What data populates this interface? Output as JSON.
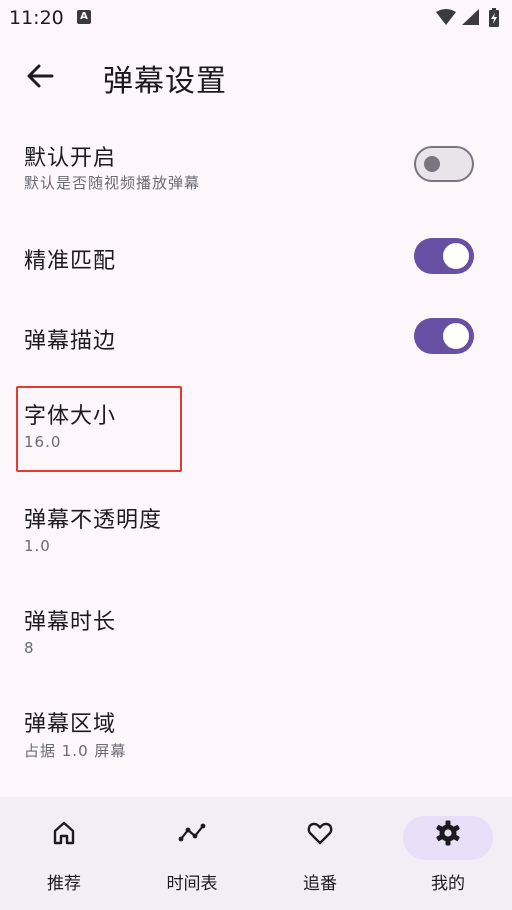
{
  "status": {
    "time": "11:20",
    "notification_icon": "a-icon"
  },
  "header": {
    "title": "弹幕设置",
    "back_icon": "arrow-left-icon"
  },
  "settings": [
    {
      "title": "默认开启",
      "subtitle": "默认是否随视频播放弹幕",
      "switch": "off"
    },
    {
      "title": "精准匹配",
      "switch": "on"
    },
    {
      "title": "弹幕描边",
      "switch": "on"
    },
    {
      "title": "字体大小",
      "subtitle": "16.0"
    },
    {
      "title": "弹幕不透明度",
      "subtitle": "1.0"
    },
    {
      "title": "弹幕时长",
      "subtitle": "8"
    },
    {
      "title": "弹幕区域",
      "subtitle": "占据 1.0 屏幕"
    }
  ],
  "nav": [
    {
      "label": "推荐",
      "icon": "home-icon"
    },
    {
      "label": "时间表",
      "icon": "timeline-icon"
    },
    {
      "label": "追番",
      "icon": "heart-icon"
    },
    {
      "label": "我的",
      "icon": "gear-icon",
      "selected": true
    }
  ],
  "colors": {
    "accent": "#6750a4",
    "background": "#fdf7fb",
    "nav_background": "#f3edf6",
    "highlight": "#e53935"
  }
}
